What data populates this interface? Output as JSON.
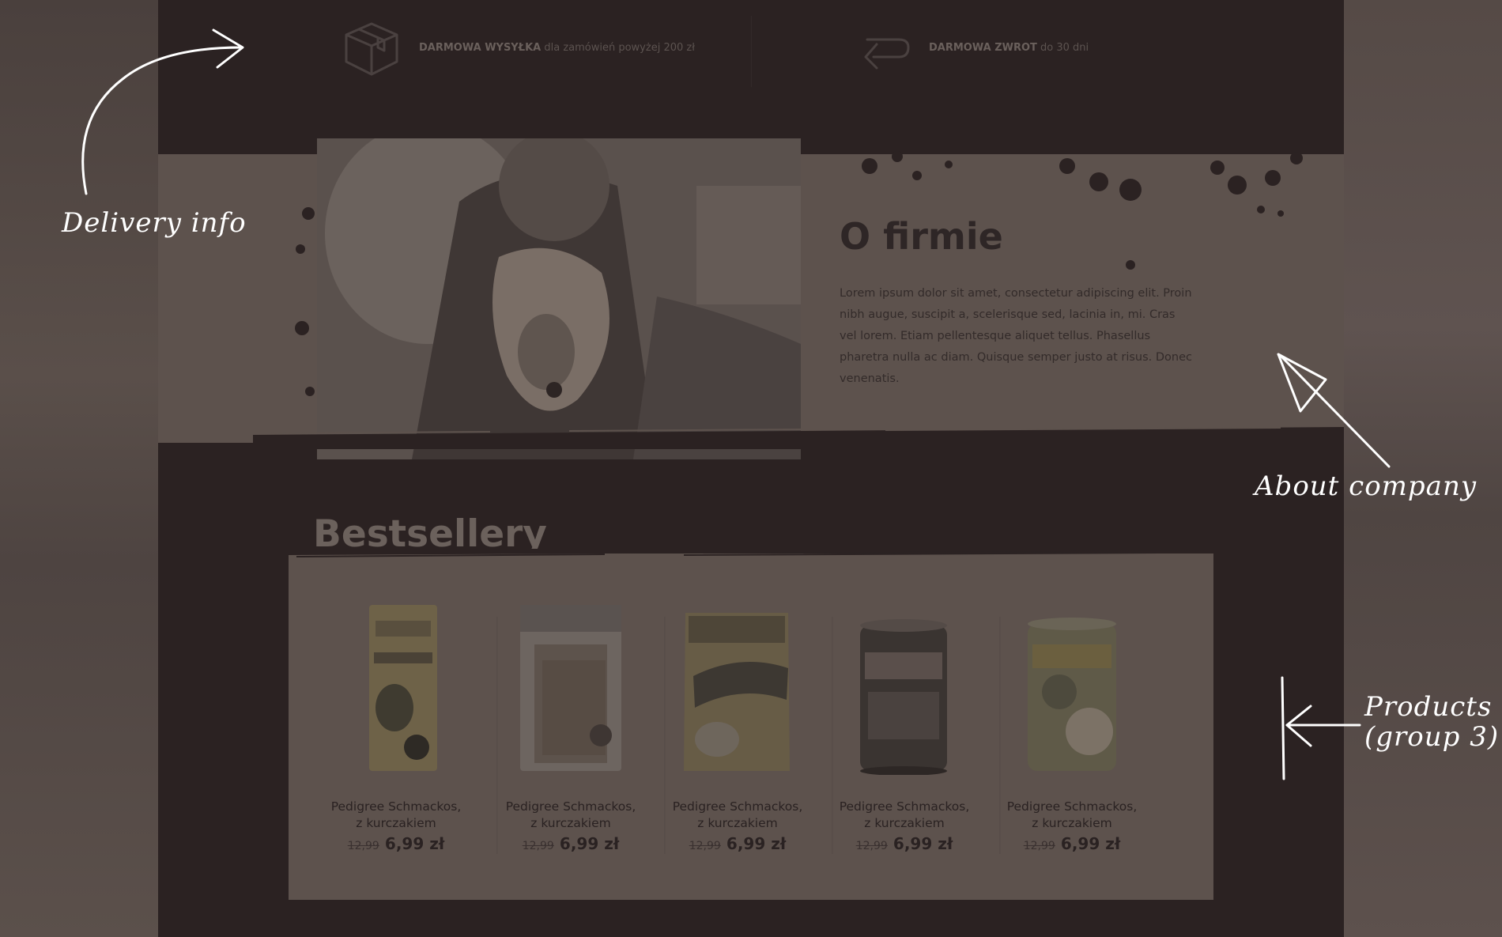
{
  "delivery": {
    "shipping_bold": "DARMOWA WYSYŁKA",
    "shipping_rest": "dla zamówień powyżej 200 zł",
    "shipping_icon": "box-icon",
    "return_bold": "DARMOWA ZWROT",
    "return_rest": "do 30 dni",
    "return_icon": "return-arrow-icon"
  },
  "about": {
    "title": "O firmie",
    "text": "Lorem ipsum dolor sit amet, consectetur adipiscing elit. Proin nibh augue, suscipit a, scelerisque sed, lacinia in, mi. Cras vel lorem. Etiam pellentesque aliquet tellus. Phasellus pharetra nulla ac diam. Quisque semper justo at risus. Donec venenatis."
  },
  "bestsellers": {
    "title": "Bestsellery",
    "products": [
      {
        "name_line1": "Pedigree Schmackos,",
        "name_line2": "z kurczakiem",
        "old_price": "12,99",
        "price": "6,99 zł"
      },
      {
        "name_line1": "Pedigree Schmackos,",
        "name_line2": "z kurczakiem",
        "old_price": "12,99",
        "price": "6,99 zł"
      },
      {
        "name_line1": "Pedigree Schmackos,",
        "name_line2": "z kurczakiem",
        "old_price": "12,99",
        "price": "6,99 zł"
      },
      {
        "name_line1": "Pedigree Schmackos,",
        "name_line2": "z kurczakiem",
        "old_price": "12,99",
        "price": "6,99 zł"
      },
      {
        "name_line1": "Pedigree Schmackos,",
        "name_line2": "z kurczakiem",
        "old_price": "12,99",
        "price": "6,99 zł"
      }
    ]
  },
  "annotations": {
    "delivery": "Delivery info",
    "about": "About company",
    "products_line1": "Products",
    "products_line2": "(group 3)"
  },
  "colors": {
    "page_bg": "#2b2222",
    "band_bg": "#5d524d",
    "annotation": "#ffffff"
  }
}
